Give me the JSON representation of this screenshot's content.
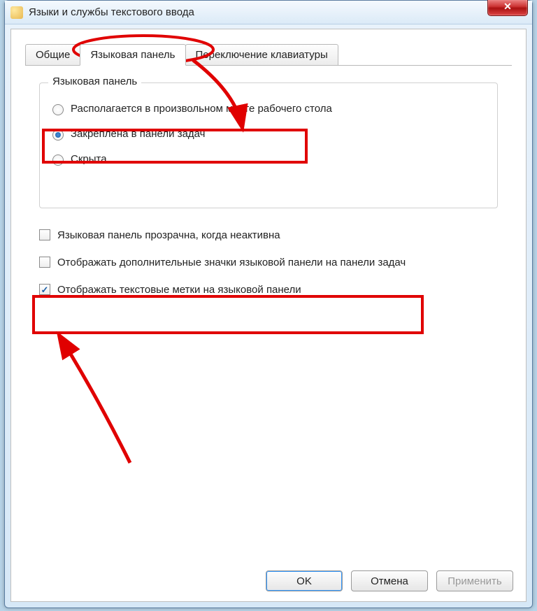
{
  "window": {
    "title": "Языки и службы текстового ввода",
    "close_glyph": "✕"
  },
  "tabs": [
    {
      "label": "Общие",
      "active": false
    },
    {
      "label": "Языковая панель",
      "active": true
    },
    {
      "label": "Переключение клавиатуры",
      "active": false
    }
  ],
  "group": {
    "legend": "Языковая панель",
    "radios": [
      {
        "label": "Располагается в произвольном месте рабочего стола",
        "selected": false
      },
      {
        "label": "Закреплена в панели задач",
        "selected": true
      },
      {
        "label": "Скрыта",
        "selected": false
      }
    ]
  },
  "checkboxes": [
    {
      "label": "Языковая панель прозрачна, когда неактивна",
      "checked": false
    },
    {
      "label": "Отображать дополнительные значки языковой панели на панели задач",
      "checked": false
    },
    {
      "label": "Отображать текстовые метки на языковой панели",
      "checked": true
    }
  ],
  "buttons": {
    "ok": "OK",
    "cancel": "Отмена",
    "apply": "Применить"
  },
  "annotations": {
    "highlight_color": "#e00000"
  }
}
